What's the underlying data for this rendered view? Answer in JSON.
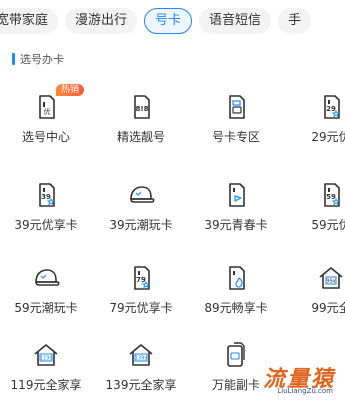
{
  "tabs": [
    {
      "label": "宽带家庭",
      "active": false
    },
    {
      "label": "漫游出行",
      "active": false
    },
    {
      "label": "号卡",
      "active": true
    },
    {
      "label": "语音短信",
      "active": false
    },
    {
      "label": "手",
      "active": false
    }
  ],
  "section": {
    "title": "选号办卡"
  },
  "rows": [
    [
      {
        "label": "选号中心",
        "icon": "sim-you-icon",
        "badge": "热销"
      },
      {
        "label": "精选靓号",
        "icon": "sim-888-icon"
      },
      {
        "label": "号卡专区",
        "icon": "sim-card-icon"
      },
      {
        "label": "29元优",
        "icon": "sim-29-icon"
      }
    ],
    [
      {
        "label": "39元优享卡",
        "icon": "sim-39-star-icon"
      },
      {
        "label": "39元潮玩卡",
        "icon": "cap-icon"
      },
      {
        "label": "39元青春卡",
        "icon": "sim-flag-icon"
      },
      {
        "label": "59元优",
        "icon": "sim-59-icon"
      }
    ],
    [
      {
        "label": "59元潮玩卡",
        "icon": "cap-icon"
      },
      {
        "label": "79元优享卡",
        "icon": "sim-79-star-icon"
      },
      {
        "label": "89元畅享卡",
        "icon": "sim-fire-icon"
      },
      {
        "label": "99元全",
        "icon": "house-99-icon"
      }
    ],
    [
      {
        "label": "119元全家享",
        "icon": "house-119-icon"
      },
      {
        "label": "139元全家享",
        "icon": "house-139-icon"
      },
      {
        "label": "万能副卡",
        "icon": "phone-sim-icon"
      }
    ]
  ],
  "icon_texts": {
    "sim_you": "优",
    "sim_888": "8!8",
    "sim_29": "29",
    "sim_39": "39",
    "sim_59": "59",
    "sim_79": "79",
    "house_99": "99x",
    "house_119": "119s",
    "house_139": "139s"
  },
  "watermark": {
    "main": "流量猿",
    "sub": "LiuLiangZu.com"
  },
  "colors": {
    "accent": "#1e8bff",
    "badge": "#ff5b3a",
    "icon_stroke": "#333333",
    "watermark": "#e1641e"
  }
}
